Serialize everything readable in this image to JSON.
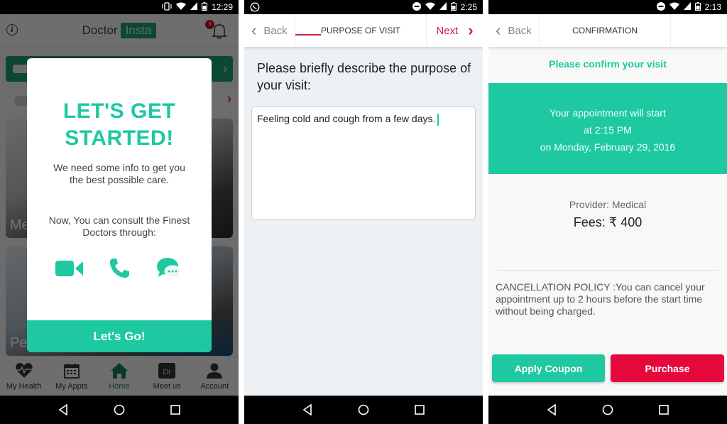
{
  "colors": {
    "accent_teal": "#1ec8a1",
    "brand_green": "#1c9b74",
    "accent_red": "#d01c43",
    "purchase_red": "#e4083d"
  },
  "screen1": {
    "status_time": "12:29",
    "app_name_part1": "Doctor",
    "app_name_part2": "Insta",
    "notification_count": "0",
    "bg_card1_label": "Me",
    "bg_card2_label": "Pe",
    "modal": {
      "title": "LET'S GET STARTED!",
      "subtitle": "We need some info to get you the best possible care.",
      "consult_text": "Now, You can consult the Finest Doctors through:",
      "icons": [
        "video-camera-icon",
        "phone-icon",
        "chat-bubble-icon"
      ],
      "button_label": "Let's Go!"
    },
    "tabs": [
      {
        "label": "My Health",
        "icon": "heart-pulse-icon",
        "active": false
      },
      {
        "label": "My Appts",
        "icon": "calendar-icon",
        "active": false
      },
      {
        "label": "Home",
        "icon": "home-icon",
        "active": true
      },
      {
        "label": "Meet us",
        "icon": "doctor-badge-icon",
        "active": false,
        "badge_text": "Dr"
      },
      {
        "label": "Account",
        "icon": "person-icon",
        "active": false
      }
    ]
  },
  "screen2": {
    "status_time": "2:25",
    "back_label": "Back",
    "title": "PURPOSE OF VISIT",
    "next_label": "Next",
    "question": "Please briefly describe the purpose of your visit:",
    "textarea_value": "Feeling cold and cough from a few days."
  },
  "screen3": {
    "status_time": "2:13",
    "back_label": "Back",
    "title": "CONFIRMATION",
    "confirm_heading": "Please confirm your visit",
    "appointment_line1": "Your appointment will start",
    "appointment_line2": "at 2:15 PM",
    "appointment_line3": "on Monday, February 29, 2016",
    "provider": "Provider: Medical",
    "fees": "Fees: ₹ 400",
    "cancellation_policy": "CANCELLATION POLICY :You can cancel your appointment up to 2 hours before the start time without being charged.",
    "apply_coupon_label": "Apply Coupon",
    "purchase_label": "Purchase"
  }
}
